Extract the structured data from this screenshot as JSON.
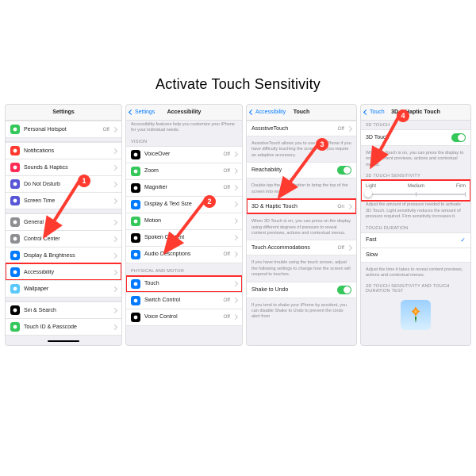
{
  "title": "Activate Touch Sensitivity",
  "steps": {
    "s1": "1",
    "s2": "2",
    "s3": "3",
    "s4": "4"
  },
  "panel1": {
    "header": "Settings",
    "items": [
      {
        "icon": "#34c759",
        "label": "Personal Hotspot",
        "value": "Off"
      },
      {
        "icon": "#ff3b30",
        "label": "Notifications"
      },
      {
        "icon": "#ff2d55",
        "label": "Sounds & Haptics"
      },
      {
        "icon": "#5856d6",
        "label": "Do Not Disturb"
      },
      {
        "icon": "#5856d6",
        "label": "Screen Time"
      },
      {
        "icon": "#8e8e93",
        "label": "General"
      },
      {
        "icon": "#8e8e93",
        "label": "Control Center"
      },
      {
        "icon": "#007aff",
        "label": "Display & Brightness"
      },
      {
        "icon": "#007aff",
        "label": "Accessibility",
        "hi": true
      },
      {
        "icon": "#5ac8fa",
        "label": "Wallpaper"
      },
      {
        "icon": "#000000",
        "label": "Siri & Search"
      },
      {
        "icon": "#34c759",
        "label": "Touch ID & Passcode"
      }
    ]
  },
  "panel2": {
    "back": "Settings",
    "header": "Accessibility",
    "note_top": "Accessibility features help you customize your iPhone for your individual needs.",
    "section_vision": "Vision",
    "vision_items": [
      {
        "icon": "#000000",
        "label": "VoiceOver",
        "value": "Off"
      },
      {
        "icon": "#34c759",
        "label": "Zoom",
        "value": "Off"
      },
      {
        "icon": "#000000",
        "label": "Magnifier",
        "value": "Off"
      },
      {
        "icon": "#007aff",
        "label": "Display & Text Size"
      },
      {
        "icon": "#34c759",
        "label": "Motion"
      },
      {
        "icon": "#000000",
        "label": "Spoken Content"
      },
      {
        "icon": "#007aff",
        "label": "Audio Descriptions",
        "value": "Off"
      }
    ],
    "section_motor": "Physical and Motor",
    "motor_items": [
      {
        "icon": "#007aff",
        "label": "Touch",
        "hi": true
      },
      {
        "icon": "#007aff",
        "label": "Switch Control",
        "value": "Off"
      },
      {
        "icon": "#000000",
        "label": "Voice Control",
        "value": "Off"
      }
    ]
  },
  "panel3": {
    "back": "Accessibility",
    "header": "Touch",
    "rows": {
      "assistive": "AssistiveTouch",
      "assistive_val": "Off",
      "assistive_note": "AssistiveTouch allows you to use your iPhone if you have difficulty touching the screen or if you require an adaptive accessory.",
      "reach": "Reachability",
      "reach_note": "Double-tap the home button to bring the top of the screen into reach.",
      "hap": "3D & Haptic Touch",
      "hap_val": "On",
      "hap_note": "When 3D Touch is on, you can press on the display using different degrees of pressure to reveal content previews, actions and contextual menus.",
      "acc": "Touch Accommodations",
      "acc_val": "Off",
      "acc_note": "If you have trouble using the touch screen, adjust the following settings to change how the screen will respond to touches.",
      "shake": "Shake to Undo",
      "shake_note": "If you tend to shake your iPhone by accident, you can disable Shake to Undo to prevent the Undo alert from"
    }
  },
  "panel4": {
    "back": "Touch",
    "header": "3D & Haptic Touch",
    "section_3d": "3D Touch",
    "row_3d": "3D Touch",
    "note_3d": "When 3D Touch is on, you can press the display to reveal content previews, actions and contextual menus.",
    "section_sens": "3D Touch Sensitivity",
    "sens_labels": {
      "l": "Light",
      "m": "Medium",
      "f": "Firm"
    },
    "note_sens": "Adjust the amount of pressure needed to activate 3D Touch. Light sensitivity reduces the amount of pressure required. Firm sensitivity increases it.",
    "section_dur": "Touch Duration",
    "dur_fast": "Fast",
    "dur_slow": "Slow",
    "note_dur": "Adjust the time it takes to reveal content previews, actions and contextual menus.",
    "section_test": "3D Touch Sensitivity and Touch Duration Test"
  }
}
